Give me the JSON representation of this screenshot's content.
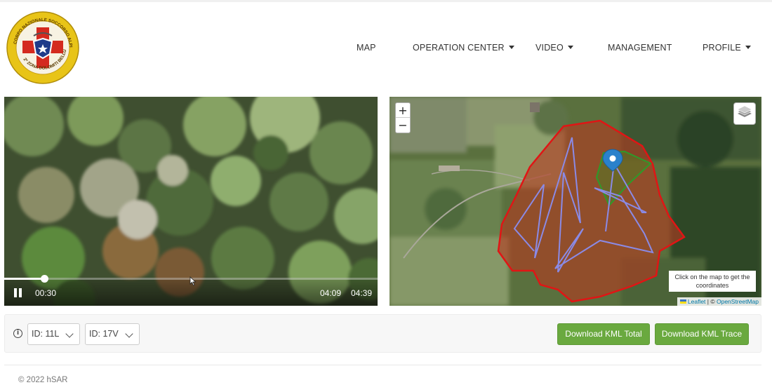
{
  "nav": {
    "logo_text": "CORPO NAZIONALE SOCCORSO ALPINO E SPELEOLOGICO · 2ª ZONA DOLOMITI BELLUNESI",
    "items": [
      {
        "label": "MAP",
        "has_dropdown": false
      },
      {
        "label": "OPERATION CENTER",
        "has_dropdown": true
      },
      {
        "label": "VIDEO",
        "has_dropdown": true
      },
      {
        "label": "MANAGEMENT",
        "has_dropdown": false
      },
      {
        "label": "PROFILE",
        "has_dropdown": true
      }
    ]
  },
  "video": {
    "current_time": "00:30",
    "mid_time": "04:09",
    "total_time": "04:39",
    "progress_fraction": 0.107
  },
  "map": {
    "zoom_in": "+",
    "zoom_out": "−",
    "hint": "Click on the map to get the coordinates",
    "attribution_leaflet": "Leaflet",
    "attribution_sep": " | © ",
    "attribution_osm": "OpenStreetMap",
    "colors": {
      "area_outline": "#e01515",
      "area_fill": "#c0301e",
      "trace": "#8a8ae6",
      "zone": "#2e9a2a",
      "marker": "#2a81cb"
    }
  },
  "controls": {
    "info_glyph": "i",
    "select_1": "ID: 11L",
    "select_2": "ID: 17V",
    "btn_total": "Download KML Total",
    "btn_trace": "Download KML Trace",
    "accent": "#6aa93f"
  },
  "footer": {
    "text": "© 2022 hSAR"
  }
}
